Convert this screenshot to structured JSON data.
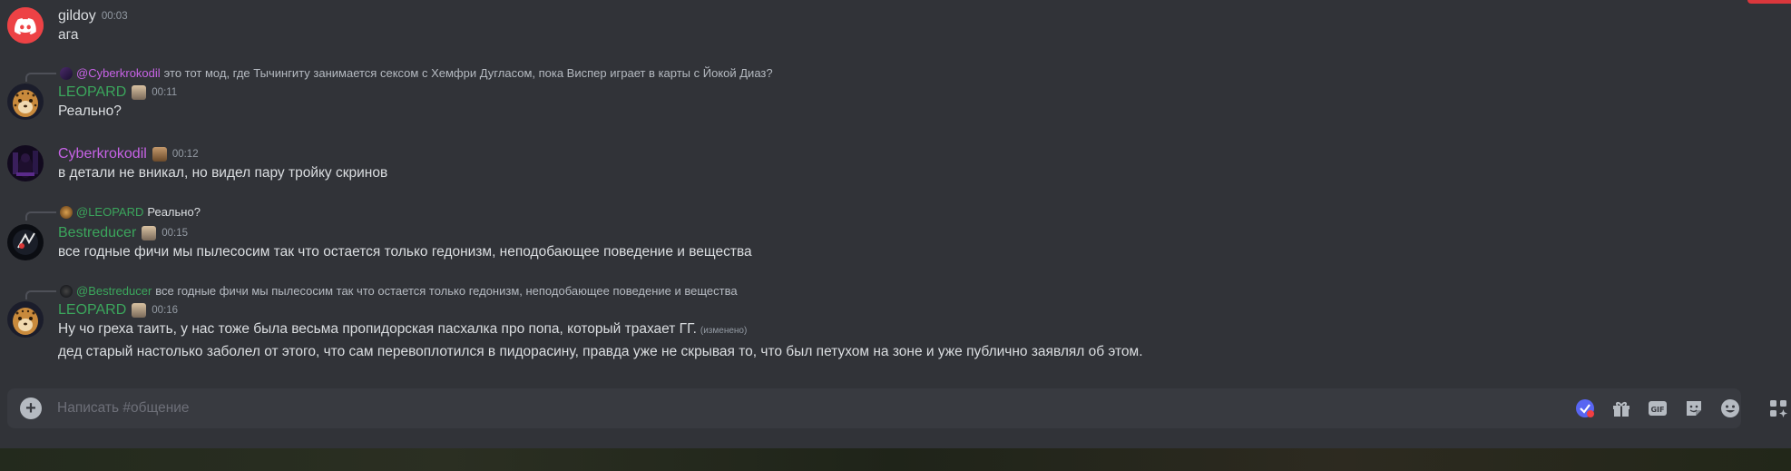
{
  "colors": {
    "background": "#313338",
    "leopard": "#3ba55c",
    "cyber": "#c763e6",
    "bestreducer": "#3ba55c",
    "discord_red": "#ed4245"
  },
  "messages": [
    {
      "username": "gildoy",
      "timestamp": "00:03",
      "text": "ага"
    },
    {
      "reply": {
        "mention": "@Cyberkrokodil",
        "text": "это тот мод, где Тычингиту занимается сексом с Хемфри Дугласом, пока Виспер играет в карты с Йокой Диаз?"
      },
      "username": "LEOPARD",
      "timestamp": "00:11",
      "text": "Реально?"
    },
    {
      "username": "Cyberkrokodil",
      "timestamp": "00:12",
      "text": "в детали не вникал, но видел пару тройку скринов"
    },
    {
      "reply": {
        "mention": "@LEOPARD",
        "text": "Реально?"
      },
      "username": "Bestreducer",
      "timestamp": "00:15",
      "text": "все годные фичи мы пылесосим так что остается только гедонизм, неподобающее поведение и вещества"
    },
    {
      "reply": {
        "mention": "@Bestreducer",
        "text": "все годные фичи мы пылесосим так что остается только гедонизм, неподобающее поведение и вещества"
      },
      "username": "LEOPARD",
      "timestamp": "00:16",
      "text": "Ну чо греха таить, у нас тоже была весьма пропидорская пасхалка про попа, который трахает ГГ.",
      "edited": "(изменено)",
      "text2": "дед старый настолько заболел от этого, что сам перевоплотился в пидорасину, правда уже не скрывая то, что был петухом на зоне и уже публично заявлял об этом."
    }
  ],
  "composer": {
    "placeholder": "Написать #общение",
    "icons": [
      "plus-icon",
      "app-launcher-icon",
      "gift-icon",
      "gif-icon",
      "sticker-icon",
      "emoji-icon",
      "apps-icon"
    ]
  }
}
